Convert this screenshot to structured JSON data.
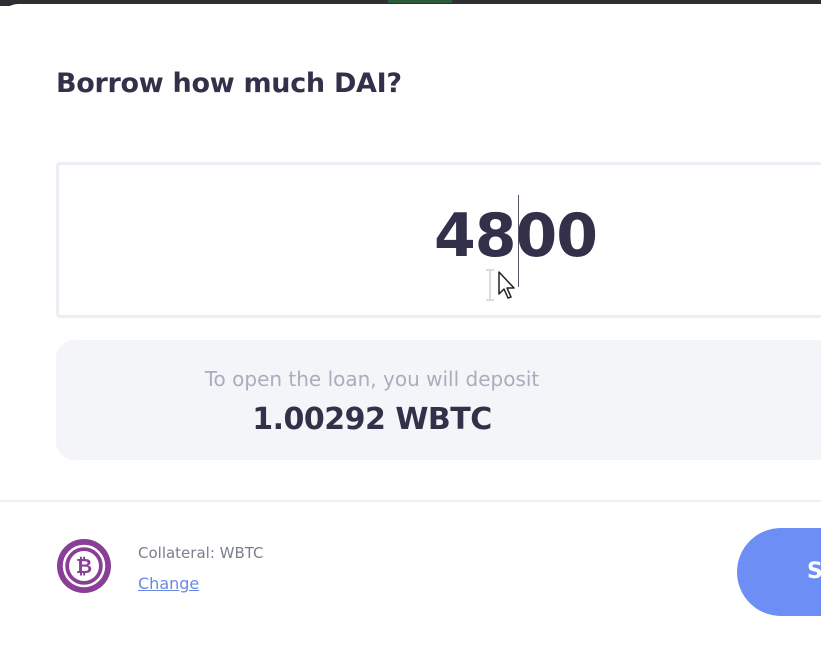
{
  "modal": {
    "title": "Borrow how much DAI?"
  },
  "amount": {
    "value": "4800"
  },
  "deposit_info": {
    "label": "To open the loan, you will deposit",
    "value": "1.00292 WBTC"
  },
  "footer": {
    "collateral_label": "Collateral: WBTC",
    "change_link": "Change",
    "submit_label": "S"
  },
  "colors": {
    "text_primary": "#323149",
    "accent": "#6c8ef5",
    "link": "#6a88e6",
    "wbtc_purple": "#8a3f96"
  },
  "icons": [
    "wbtc-bitcoin-icon",
    "mouse-pointer-icon",
    "text-ibeam-icon"
  ]
}
